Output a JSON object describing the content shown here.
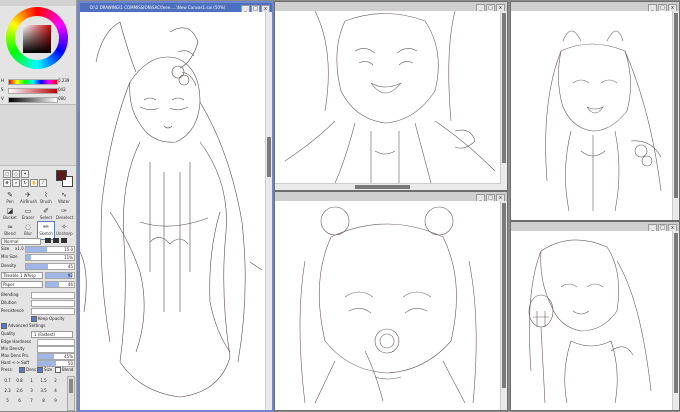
{
  "color_panel": {
    "title": "",
    "sliders": [
      {
        "label": "H",
        "value": "0.239",
        "fill": 0.66
      },
      {
        "label": "S",
        "value": "042",
        "fill": 0.16
      },
      {
        "label": "V",
        "value": "080",
        "fill": 0.31
      }
    ]
  },
  "tools": {
    "row1": [
      "Pen",
      "AirBrush",
      "Brush",
      "Water"
    ],
    "row2": [
      "Bucket",
      "Eraser",
      "Select",
      "Deselect"
    ],
    "row3": [
      "Blend",
      "Blur",
      "Sketch",
      "Unsharp"
    ],
    "selected": "Sketch"
  },
  "brush": {
    "mode": "Normal",
    "size_label": "Size",
    "size_multiplier": "x1.0",
    "size_value": "15.0",
    "min_size_label": "Min Size",
    "min_size_value": "11%",
    "density_label": "Density",
    "density_value": "45",
    "texture_name": "Tileable 1 Whisp",
    "texture_value": "92",
    "paper_label": "Paper",
    "paper_value": "46",
    "blending_label": "Blending",
    "dilution_label": "Dilution",
    "persistence_label": "Persistence",
    "keep_opacity_label": "Keep Opacity",
    "advanced_label": "Advanced Settings",
    "quality_label": "Quality",
    "quality_value": "1 (Fastest)",
    "edge_hardness_label": "Edge Hardness",
    "min_density_label": "Min Density",
    "max_dens_prs_label": "Max Dens Prs.",
    "max_dens_prs_value": "45%",
    "hard_soft_label": "Hard <-> Soft",
    "hard_soft_value": "50",
    "press_label": "Press:",
    "press_opts": [
      "Dens",
      "Size",
      "Blend"
    ],
    "size_presets": [
      "0.7",
      "0.8",
      "1",
      "1.5",
      "2",
      "2.3",
      "2.6",
      "3",
      "3.5",
      "4",
      "5",
      "6",
      "7",
      "8",
      "9"
    ]
  },
  "windows": [
    {
      "title": "D:\\2 DRAWING\\1 COMMISSION\\SAC\\feee.....\\New Canvas1.sai (50%)",
      "active": true
    },
    {
      "title": "",
      "active": false
    },
    {
      "title": "",
      "active": false
    },
    {
      "title": "",
      "active": false
    },
    {
      "title": "",
      "active": false
    }
  ],
  "window_buttons": [
    "_",
    "□",
    "x"
  ],
  "colors": {
    "accent": "#4d6fbf",
    "selection": "#5a79c8",
    "primary_color": "#5e1a1a"
  }
}
